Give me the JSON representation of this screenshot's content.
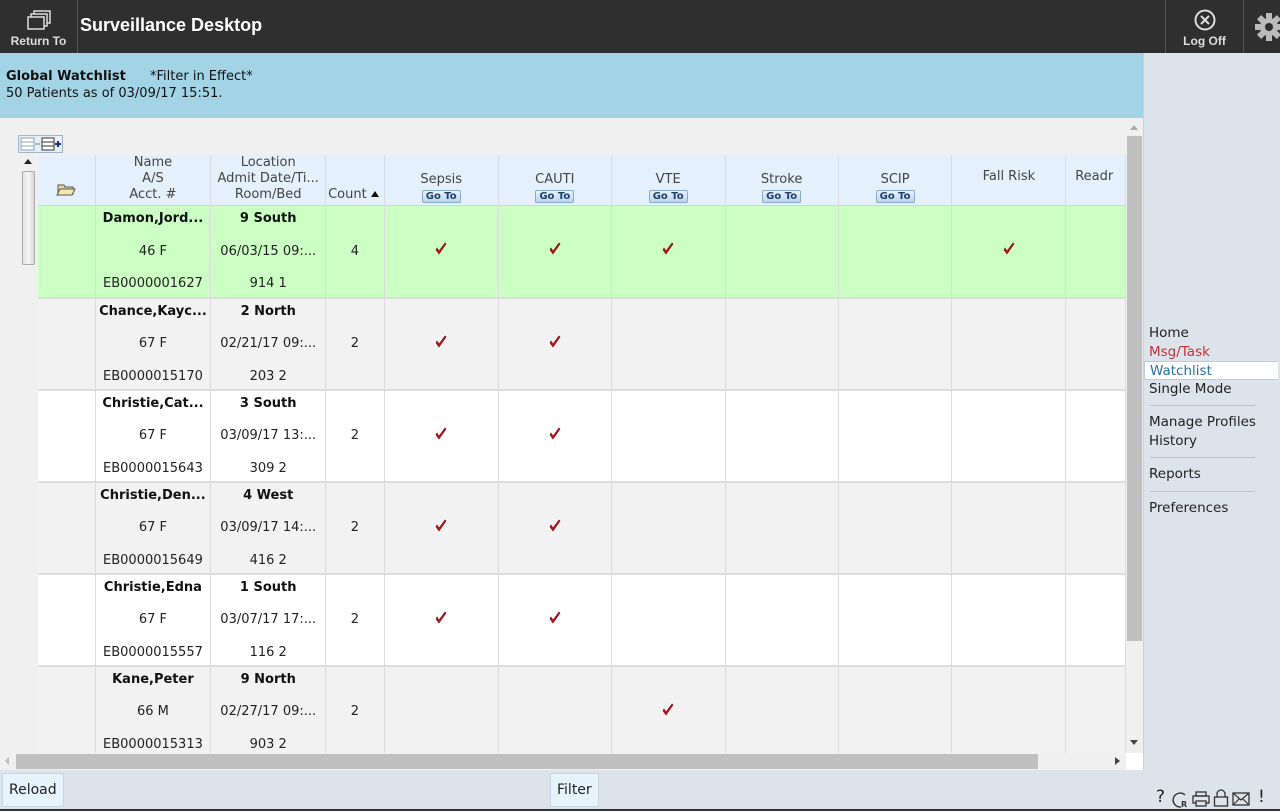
{
  "header": {
    "return_label": "Return To",
    "app_title": "Surveillance Desktop",
    "logoff_label": "Log Off"
  },
  "info": {
    "title": "Global Watchlist",
    "filter_status": "*Filter in Effect*",
    "patient_count": "50 Patients as of 03/09/17 15:51."
  },
  "grid": {
    "columns": {
      "name": [
        "Name",
        "A/S",
        "Acct. #"
      ],
      "location": [
        "Location",
        "Admit Date/Ti...",
        "Room/Bed"
      ],
      "count": "Count",
      "sepsis": "Sepsis",
      "cauti": "CAUTI",
      "vte": "VTE",
      "stroke": "Stroke",
      "scip": "SCIP",
      "fall_risk": "Fall Risk",
      "readm": "Readr"
    },
    "goto_label": "Go To",
    "rows": [
      {
        "name": "Damon,Jord...",
        "as": "46 F",
        "acct": "EB0000001627",
        "unit": "9 South",
        "admit": "06/03/15 09:...",
        "bed": "914 1",
        "count": "4",
        "sepsis": true,
        "cauti": true,
        "vte": true,
        "stroke": false,
        "scip": false,
        "fall_risk": true,
        "readm": false,
        "selected": true
      },
      {
        "name": "Chance,Kayc...",
        "as": "67 F",
        "acct": "EB0000015170",
        "unit": "2 North",
        "admit": "02/21/17 09:...",
        "bed": "203 2",
        "count": "2",
        "sepsis": true,
        "cauti": true,
        "vte": false,
        "stroke": false,
        "scip": false,
        "fall_risk": false,
        "readm": false,
        "selected": false
      },
      {
        "name": "Christie,Cat...",
        "as": "67 F",
        "acct": "EB0000015643",
        "unit": "3 South",
        "admit": "03/09/17 13:...",
        "bed": "309 2",
        "count": "2",
        "sepsis": true,
        "cauti": true,
        "vte": false,
        "stroke": false,
        "scip": false,
        "fall_risk": false,
        "readm": false,
        "selected": false
      },
      {
        "name": "Christie,Den...",
        "as": "67 F",
        "acct": "EB0000015649",
        "unit": "4 West",
        "admit": "03/09/17 14:...",
        "bed": "416 2",
        "count": "2",
        "sepsis": true,
        "cauti": true,
        "vte": false,
        "stroke": false,
        "scip": false,
        "fall_risk": false,
        "readm": false,
        "selected": false
      },
      {
        "name": "Christie,Edna",
        "as": "67 F",
        "acct": "EB0000015557",
        "unit": "1 South",
        "admit": "03/07/17 17:...",
        "bed": "116 2",
        "count": "2",
        "sepsis": true,
        "cauti": true,
        "vte": false,
        "stroke": false,
        "scip": false,
        "fall_risk": false,
        "readm": false,
        "selected": false
      },
      {
        "name": "Kane,Peter",
        "as": "66 M",
        "acct": "EB0000015313",
        "unit": "9 North",
        "admit": "02/27/17 09:...",
        "bed": "903 2",
        "count": "2",
        "sepsis": false,
        "cauti": false,
        "vte": true,
        "stroke": false,
        "scip": false,
        "fall_risk": false,
        "readm": false,
        "selected": false
      }
    ]
  },
  "sidebar": {
    "items": [
      {
        "label": "Home"
      },
      {
        "label": "Msg/Task"
      },
      {
        "label": "Watchlist"
      },
      {
        "label": "Single Mode"
      },
      {
        "label": "Manage Profiles"
      },
      {
        "label": "History"
      },
      {
        "label": "Reports"
      },
      {
        "label": "Preferences"
      }
    ]
  },
  "footer": {
    "reload_label": "Reload",
    "filter_label": "Filter",
    "utility_icons": [
      "help-icon",
      "refresh-icon",
      "print-icon",
      "lock-icon",
      "mail-icon",
      "alert-icon"
    ],
    "help_glyph": "?",
    "alert_glyph": "!"
  },
  "colors": {
    "selected_row": "#ccffc4",
    "info_bar": "#a3d4e5",
    "topbar": "#2f2f2f",
    "check": "#c0141a",
    "msg_task": "#c8303a",
    "watchlist_active": "#2f6f9f"
  }
}
